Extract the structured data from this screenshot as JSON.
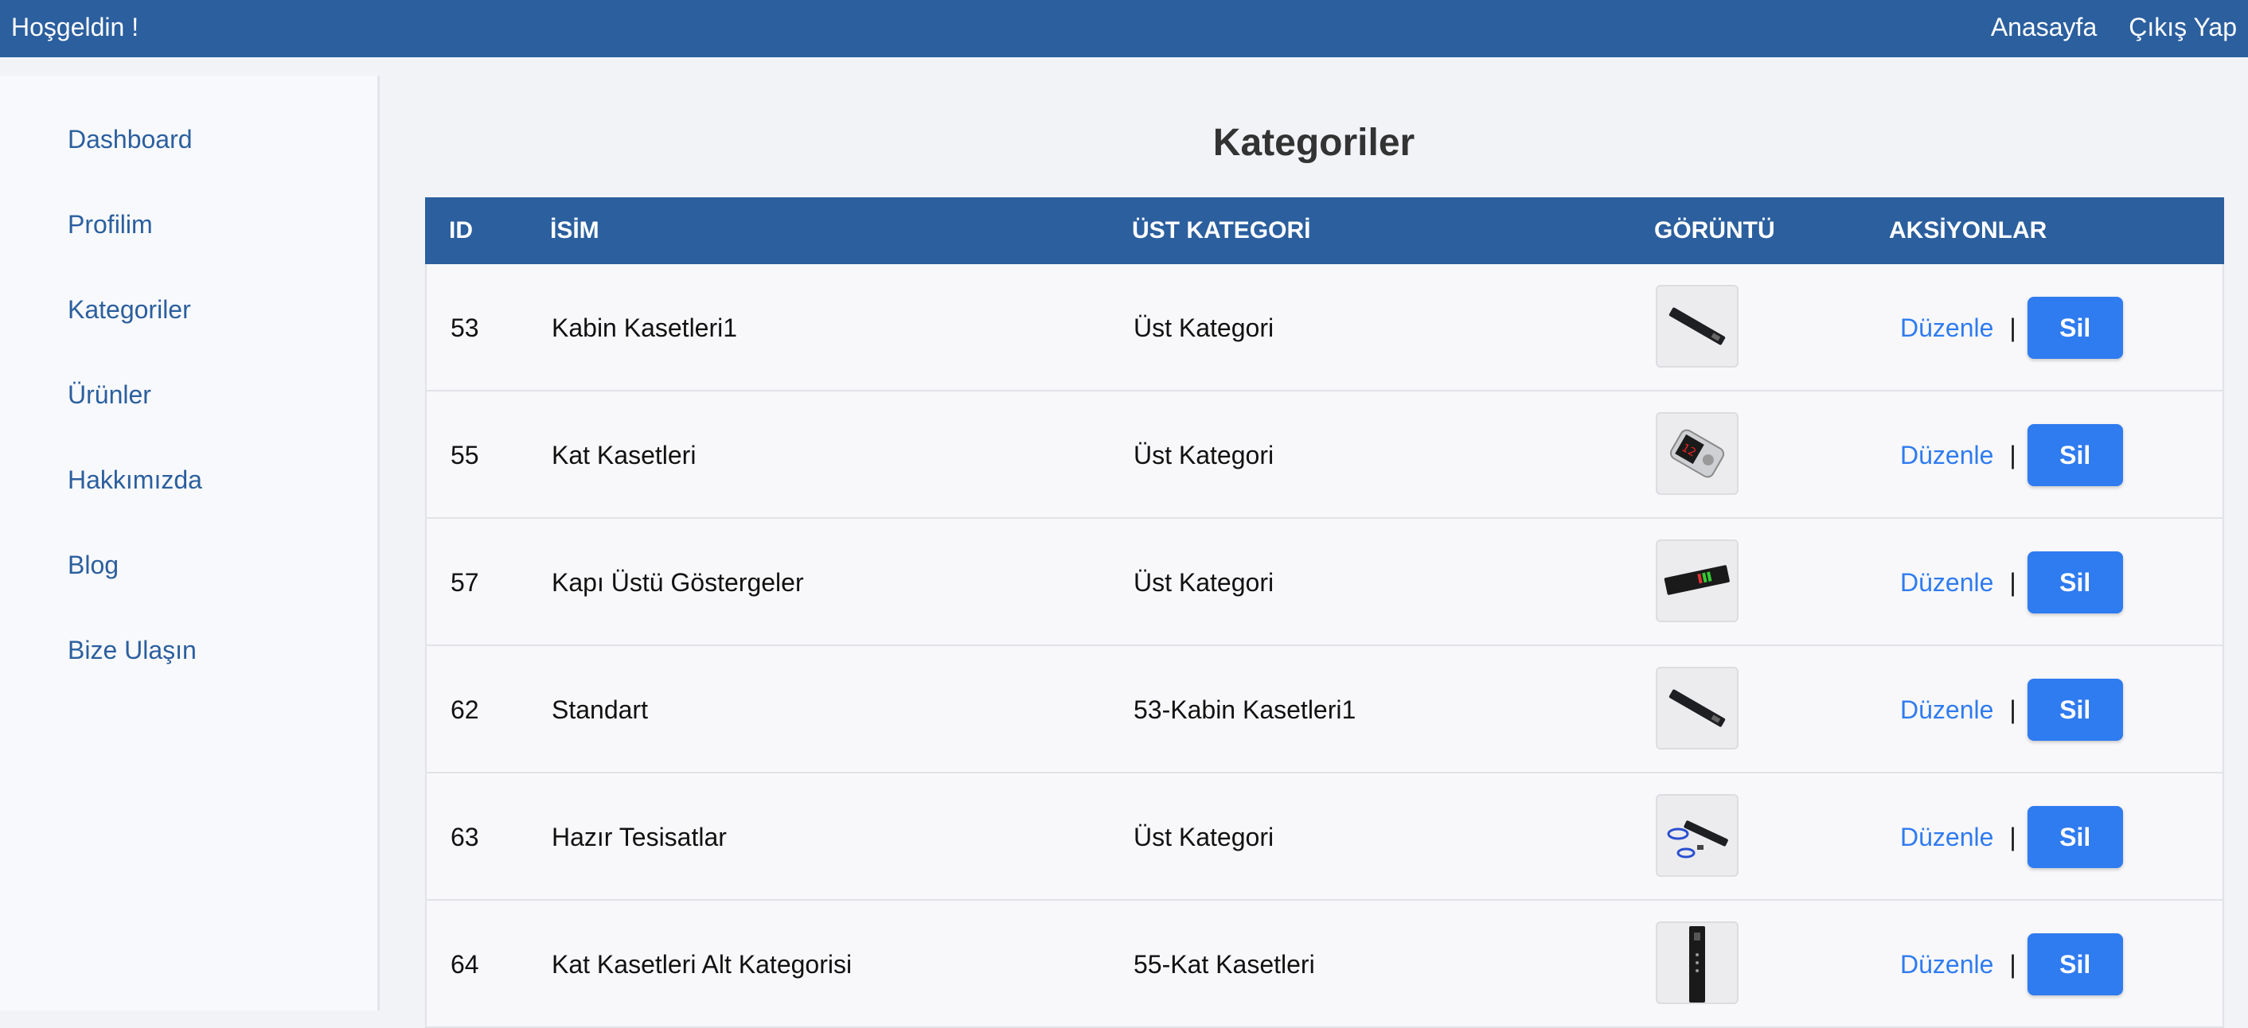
{
  "topbar": {
    "welcome": "Hoşgeldin !",
    "home_link": "Anasayfa",
    "logout_link": "Çıkış Yap"
  },
  "sidebar": {
    "items": [
      {
        "label": "Dashboard"
      },
      {
        "label": "Profilim"
      },
      {
        "label": "Kategoriler"
      },
      {
        "label": "Ürünler"
      },
      {
        "label": "Hakkımızda"
      },
      {
        "label": "Blog"
      },
      {
        "label": "Bize Ulaşın"
      }
    ]
  },
  "main": {
    "title": "Kategoriler",
    "table": {
      "headers": [
        "ID",
        "İSİM",
        "ÜST KATEGORİ",
        "GÖRÜNTÜ",
        "AKSİYONLAR"
      ],
      "rows": [
        {
          "id": "53",
          "name": "Kabin Kasetleri1",
          "parent": "Üst Kategori",
          "image_icon": "panel-flat-icon"
        },
        {
          "id": "55",
          "name": "Kat Kasetleri",
          "parent": "Üst Kategori",
          "image_icon": "panel-display-icon"
        },
        {
          "id": "57",
          "name": "Kapı Üstü Göstergeler",
          "parent": "Üst Kategori",
          "image_icon": "indicator-bar-icon"
        },
        {
          "id": "62",
          "name": "Standart",
          "parent": "53-Kabin Kasetleri1",
          "image_icon": "panel-flat-icon"
        },
        {
          "id": "63",
          "name": "Hazır Tesisatlar",
          "parent": "Üst Kategori",
          "image_icon": "wiring-kit-icon"
        },
        {
          "id": "64",
          "name": "Kat Kasetleri Alt Kategorisi",
          "parent": "55-Kat Kasetleri",
          "image_icon": "vertical-panel-icon"
        }
      ],
      "edit_label": "Düzenle",
      "separator": "|",
      "delete_label": "Sil"
    }
  },
  "colors": {
    "brand": "#2b5f9e",
    "accent": "#2f7bf0",
    "background": "#f2f3f7"
  }
}
